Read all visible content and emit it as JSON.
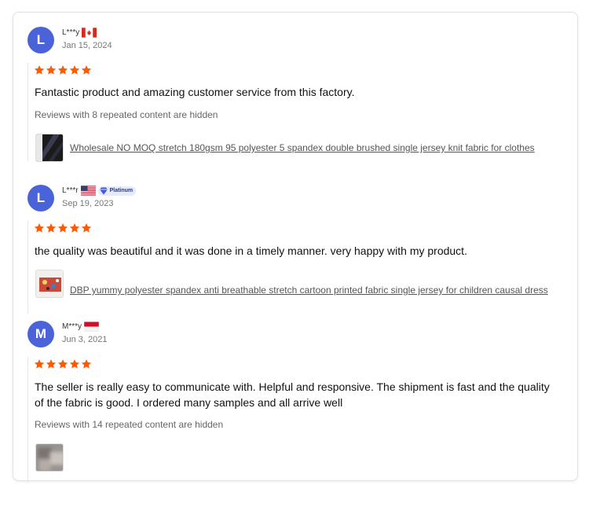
{
  "reviews": [
    {
      "initial": "L",
      "user": "L***y",
      "country_flag": "canada-flag",
      "badge": null,
      "date": "Jan 15, 2024",
      "rating": 5,
      "text": "Fantastic product and amazing customer service from this factory.",
      "hidden_note": "Reviews with 8 repeated content are hidden",
      "product_link": "Wholesale NO MOQ stretch 180gsm 95 polyester 5 spandex double brushed single jersey knit fabric for clothes",
      "thumbnail": "black-fabric-thumbnail"
    },
    {
      "initial": "L",
      "user": "L***r",
      "country_flag": "usa-flag",
      "badge": "Platinum",
      "date": "Sep 19, 2023",
      "rating": 5,
      "text": "the quality was beautiful and it was done in a timely manner. very happy with my product.",
      "hidden_note": null,
      "product_link": "DBP yummy polyester spandex anti breathable stretch cartoon printed fabric single jersey for children causal dress",
      "thumbnail": "printed-fabric-thumbnail"
    },
    {
      "initial": "M",
      "user": "M***y",
      "country_flag": "indonesia-flag",
      "badge": null,
      "date": "Jun 3, 2021",
      "rating": 5,
      "text": "The seller is really easy to communicate with. Helpful and responsive. The shipment is fast and the quality of the fabric is good. I ordered many samples and all arrive well",
      "hidden_note": "Reviews with 14 repeated content are hidden",
      "product_link": null,
      "thumbnail": "blurred-photo-thumbnail"
    }
  ],
  "colors": {
    "avatar": "#4b63d8",
    "star": "#ff5a00",
    "link": "#555555"
  }
}
